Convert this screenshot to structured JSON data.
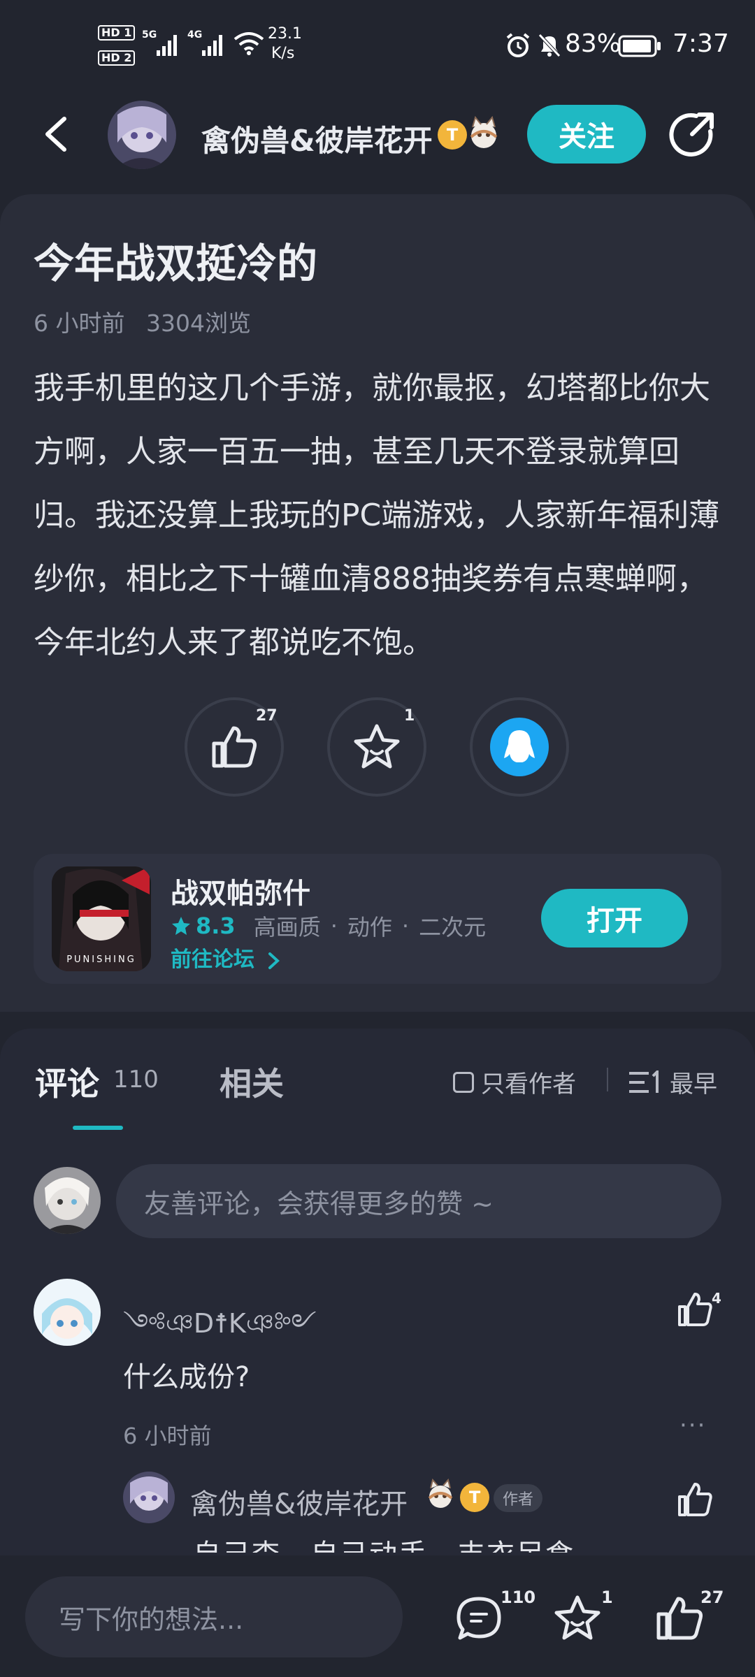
{
  "status_bar": {
    "hd1": "HD 1",
    "hd2": "HD 2",
    "net1": "5G",
    "net2": "4G",
    "speed": "23.1",
    "speed_unit": "K/s",
    "battery": "83%",
    "time": "7:37"
  },
  "header": {
    "author_name": "禽伪兽&彼岸花开",
    "badge_letter": "T",
    "follow_label": "关注"
  },
  "post": {
    "title": "今年战双挺冷的",
    "time": "6 小时前",
    "views": "3304浏览",
    "body": "我手机里的这几个手游，就你最抠，幻塔都比你大方啊，人家一百五一抽，甚至几天不登录就算回归。我还没算上我玩的PC端游戏，人家新年福利薄纱你，相比之下十罐血清888抽奖券有点寒蝉啊，今年北约人来了都说吃不饱。",
    "like_count": "27",
    "star_count": "1"
  },
  "game": {
    "name": "战双帕弥什",
    "icon_text": "PUNISHING",
    "rating": "8.3",
    "tag1": "高画质",
    "tag2": "动作",
    "tag3": "二次元",
    "sep": "·",
    "forum_link": "前往论坛",
    "open_label": "打开"
  },
  "comments_section": {
    "tab_comments": "评论",
    "comments_count": "110",
    "tab_related": "相关",
    "only_author": "只看作者",
    "sort_label": "最早",
    "input_placeholder": "友善评论，会获得更多的赞 ~"
  },
  "comment": {
    "name": "༺ঞD☨Kঞ༻",
    "text": "什么成份?",
    "time": "6 小时前",
    "more": "···",
    "like_count": "4"
  },
  "reply": {
    "name": "禽伪兽&彼岸花开",
    "badge_letter": "T",
    "author_tag": "作者",
    "text": "自己查　自己动手　丰衣足食"
  },
  "bottom_bar": {
    "placeholder": "写下你的想法...",
    "comment_count": "110",
    "star_count": "1",
    "like_count": "27"
  },
  "colors": {
    "accent": "#1fb9c3",
    "background": "#22252f",
    "card": "#2a2d39",
    "qq_blue": "#1ca6f2"
  }
}
